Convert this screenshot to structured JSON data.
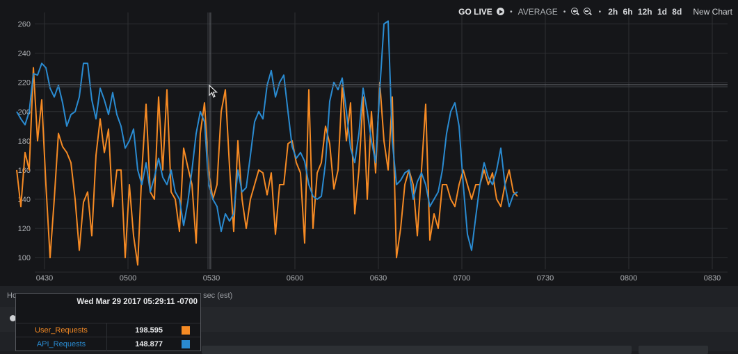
{
  "toolbar": {
    "go_live": "GO LIVE",
    "aggregation": "AVERAGE",
    "ranges": [
      "2h",
      "6h",
      "12h",
      "1d",
      "8d"
    ],
    "new_chart": "New Chart"
  },
  "footer": {
    "label_visible": "Ho",
    "label_tail": "sec (est)"
  },
  "tooltip": {
    "timestamp": "Wed Mar 29 2017 05:29:11 -0700",
    "rows": [
      {
        "name": "User_Requests",
        "value": "198.595",
        "color": "#f58a24"
      },
      {
        "name": "API_Requests",
        "value": "148.877",
        "color": "#2a8bd1"
      }
    ]
  },
  "chart_data": {
    "type": "line",
    "xlim": [
      0,
      36
    ],
    "ylim": [
      92,
      265
    ],
    "yticks": [
      100,
      120,
      140,
      160,
      180,
      200,
      220,
      240,
      260
    ],
    "xticks": [
      {
        "x": 2,
        "label": "0430"
      },
      {
        "x": 8,
        "label": "0500"
      },
      {
        "x": 14,
        "label": "0530"
      },
      {
        "x": 20,
        "label": "0600"
      },
      {
        "x": 26,
        "label": "0630"
      },
      {
        "x": 32,
        "label": "0700"
      },
      {
        "x": 38,
        "label": "0730"
      },
      {
        "x": 44,
        "label": "0800"
      },
      {
        "x": 50,
        "label": "0830"
      }
    ],
    "grid": true,
    "series": [
      {
        "name": "User_Requests",
        "color": "#f58a24",
        "x": [
          0,
          0.3,
          0.6,
          0.9,
          1.2,
          1.5,
          1.8,
          2.1,
          2.4,
          2.7,
          3.0,
          3.3,
          3.6,
          3.9,
          4.2,
          4.5,
          4.8,
          5.1,
          5.4,
          5.7,
          6.0,
          6.3,
          6.6,
          6.9,
          7.2,
          7.5,
          7.8,
          8.1,
          8.4,
          8.7,
          9.0,
          9.3,
          9.6,
          9.9,
          10.2,
          10.5,
          10.8,
          11.1,
          11.4,
          11.7,
          12.0,
          12.3,
          12.6,
          12.9,
          13.2,
          13.5,
          13.8,
          14.1,
          14.4,
          14.7,
          15.0,
          15.3,
          15.6,
          15.9,
          16.2,
          16.5,
          16.8,
          17.1,
          17.4,
          17.7,
          18.0,
          18.3,
          18.6,
          18.9,
          19.2,
          19.5,
          19.8,
          20.1,
          20.4,
          20.7,
          21.0,
          21.3,
          21.6,
          21.9,
          22.2,
          22.5,
          22.8,
          23.1,
          23.4,
          23.7,
          24.0,
          24.3,
          24.6,
          24.9,
          25.2,
          25.5,
          25.8,
          26.1,
          26.4,
          26.7,
          27.0,
          27.3,
          27.6,
          27.9,
          28.2,
          28.5,
          28.8,
          29.1,
          29.4,
          29.7,
          30.0,
          30.3,
          30.6,
          30.9,
          31.2,
          31.5,
          31.8,
          32.1,
          32.4,
          32.7,
          33.0,
          33.3,
          33.6,
          33.9,
          34.2,
          34.5,
          34.8,
          35.1,
          35.4,
          35.7,
          36.0
        ],
        "values": [
          160,
          135,
          172,
          160,
          230,
          180,
          208,
          150,
          100,
          140,
          185,
          176,
          172,
          165,
          140,
          105,
          138,
          145,
          115,
          170,
          195,
          172,
          188,
          135,
          160,
          160,
          100,
          150,
          115,
          95,
          160,
          205,
          145,
          140,
          210,
          160,
          215,
          145,
          140,
          118,
          175,
          162,
          150,
          110,
          185,
          206,
          160,
          140,
          150,
          200,
          215,
          162,
          118,
          180,
          140,
          120,
          140,
          150,
          160,
          158,
          143,
          158,
          116,
          150,
          150,
          178,
          180,
          165,
          158,
          110,
          215,
          120,
          158,
          165,
          190,
          178,
          147,
          160,
          218,
          180,
          206,
          130,
          160,
          210,
          140,
          200,
          158,
          220,
          180,
          160,
          210,
          100,
          120,
          150,
          160,
          150,
          115,
          160,
          205,
          112,
          130,
          120,
          150,
          150,
          140,
          135,
          150,
          160,
          150,
          140,
          150,
          150,
          160,
          150,
          158,
          140,
          135,
          150,
          160,
          145,
          142
        ]
      },
      {
        "name": "API_Requests",
        "color": "#2a8bd1",
        "x": [
          0,
          0.3,
          0.6,
          0.9,
          1.2,
          1.5,
          1.8,
          2.1,
          2.4,
          2.7,
          3.0,
          3.3,
          3.6,
          3.9,
          4.2,
          4.5,
          4.8,
          5.1,
          5.4,
          5.7,
          6.0,
          6.3,
          6.6,
          6.9,
          7.2,
          7.5,
          7.8,
          8.1,
          8.4,
          8.7,
          9.0,
          9.3,
          9.6,
          9.9,
          10.2,
          10.5,
          10.8,
          11.1,
          11.4,
          11.7,
          12.0,
          12.3,
          12.6,
          12.9,
          13.2,
          13.5,
          13.8,
          14.1,
          14.4,
          14.7,
          15.0,
          15.3,
          15.6,
          15.9,
          16.2,
          16.5,
          16.8,
          17.1,
          17.4,
          17.7,
          18.0,
          18.3,
          18.6,
          18.9,
          19.2,
          19.5,
          19.8,
          20.1,
          20.4,
          20.7,
          21.0,
          21.3,
          21.6,
          21.9,
          22.2,
          22.5,
          22.8,
          23.1,
          23.4,
          23.7,
          24.0,
          24.3,
          24.6,
          24.9,
          25.2,
          25.5,
          25.8,
          26.1,
          26.4,
          26.7,
          27.0,
          27.3,
          27.6,
          27.9,
          28.2,
          28.5,
          28.8,
          29.1,
          29.4,
          29.7,
          30.0,
          30.3,
          30.6,
          30.9,
          31.2,
          31.5,
          31.8,
          32.1,
          32.4,
          32.7,
          33.0,
          33.3,
          33.6,
          33.9,
          34.2,
          34.5,
          34.8,
          35.1,
          35.4,
          35.7,
          36.0
        ],
        "values": [
          200,
          195,
          191,
          200,
          226,
          225,
          233,
          230,
          216,
          210,
          218,
          206,
          190,
          198,
          200,
          210,
          233,
          233,
          208,
          195,
          216,
          208,
          198,
          213,
          198,
          190,
          175,
          180,
          188,
          160,
          150,
          165,
          145,
          155,
          168,
          155,
          150,
          160,
          145,
          140,
          122,
          138,
          160,
          185,
          200,
          193,
          150,
          140,
          135,
          118,
          130,
          125,
          130,
          160,
          145,
          148,
          170,
          193,
          200,
          195,
          218,
          228,
          210,
          220,
          225,
          200,
          176,
          168,
          172,
          166,
          150,
          142,
          140,
          142,
          165,
          207,
          220,
          215,
          223,
          200,
          175,
          165,
          185,
          216,
          200,
          180,
          165,
          215,
          260,
          262,
          180,
          150,
          153,
          158,
          160,
          140,
          152,
          158,
          150,
          135,
          140,
          145,
          160,
          185,
          200,
          206,
          190,
          150,
          116,
          105,
          128,
          150,
          165,
          155,
          150,
          160,
          175,
          150,
          135,
          143,
          145
        ]
      }
    ]
  }
}
